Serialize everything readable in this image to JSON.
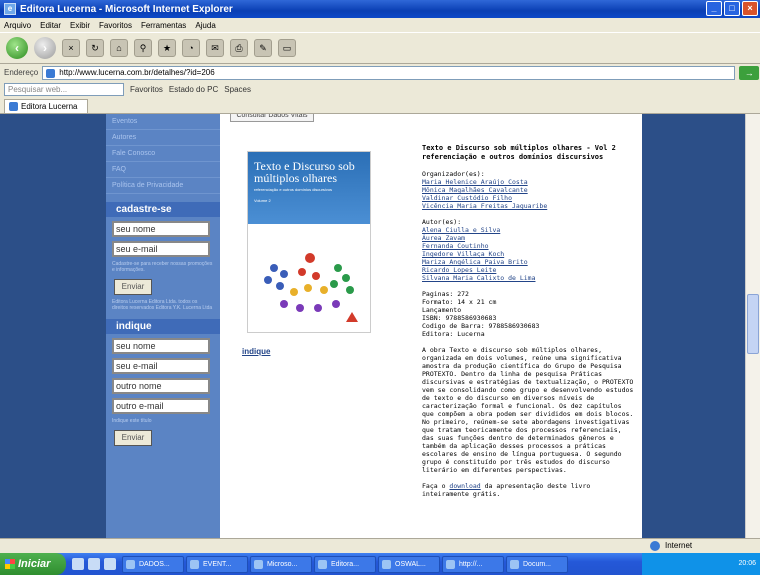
{
  "window": {
    "title": "Editora Lucerna - Microsoft Internet Explorer"
  },
  "menu": [
    "Arquivo",
    "Editar",
    "Exibir",
    "Favoritos",
    "Ferramentas",
    "Ajuda"
  ],
  "address": {
    "label": "Endereço",
    "url": "http://www.lucerna.com.br/detalhes/?id=206"
  },
  "links_bar": {
    "search_placeholder": "Pesquisar web...",
    "favorites": "Favoritos",
    "estado": "Estado do PC",
    "spaces": "Spaces"
  },
  "tab": {
    "label": "Editora Lucerna"
  },
  "sidebar": {
    "links": [
      "Eventos",
      "Autores",
      "Fale Conosco",
      "FAQ",
      "Política de Privacidade"
    ],
    "cadastre": {
      "heading": "cadastre-se",
      "name_value": "seu nome",
      "email_value": "seu e-mail",
      "note": "Cadastre-se para receber nossas promoções e informações.",
      "button": "Enviar",
      "footer_note": "Editora Lucerna Editora Ltda. todos os direitos reservados Editora Y.K. Lucerna Ltda"
    },
    "indique": {
      "heading": "indique",
      "name_value": "seu nome",
      "email_value": "seu e-mail",
      "other_name_value": "outro nome",
      "other_email_value": "outro e-mail",
      "note": "Indique este título",
      "button": "Enviar"
    }
  },
  "content": {
    "top_button": "Consultar Dados Vitais",
    "cover": {
      "title": "Texto e Discurso sob múltiplos olhares",
      "subtitle": "referenciação e outros domínios discursivos",
      "volume": "Volume 2"
    },
    "indique_link": "indique",
    "book_title": "Texto e Discurso sob múltiplos olhares - Vol 2",
    "book_subtitle": "referenciação e outros domínios discursivos",
    "organizers_label": "Organizador(es):",
    "organizers": [
      "Maria Helenice Araújo Costa",
      "Mônica Magalhães Cavalcante",
      "Valdinar Custódio Filho",
      "Vicência Maria Freitas Jaguaribe"
    ],
    "authors_label": "Autor(es):",
    "authors": [
      "Alena Ciulla e Silva",
      "Áurea Zavam",
      "Fernanda Coutinho",
      "Ingedore Villaça Koch",
      "Mariza Angélica Paiva Brito",
      "Ricardo Lopes Leite",
      "Silvana Maria Calixto de Lima"
    ],
    "details": [
      "Paginas: 272",
      "Formato: 14 x 21 cm",
      "Lançamento",
      "ISBN: 9788586930683",
      "Codigo de Barra: 9788586930683",
      "Editora: Lucerna"
    ],
    "description": "A obra Texto e discurso sob múltiplos olhares, organizada em dois volumes, reúne uma significativa amostra da produção científica do Grupo de Pesquisa PROTEXTO. Dentro da linha de pesquisa Práticas discursivas e estratégias de textualização, o PROTEXTO vem se consolidando como grupo e desenvolvendo estudos de texto e do discurso em diversos níveis de caracterização formal e funcional. Os dez capítulos que compõem a obra podem ser divididos em dois blocos. No primeiro, reúnem-se sete abordagens investigativas que tratam teoricamente dos processos referenciais, das suas funções dentro de determinados gêneros e também da aplicação desses processos a práticas escolares de ensino de língua portuguesa. O segundo grupo é constituído por três estudos do discurso literário em diferentes perspectivas.",
    "download_pre": "Faça o ",
    "download_link": "download",
    "download_post": " da apresentação deste livro inteiramente grátis."
  },
  "status": {
    "zone": "Internet"
  },
  "taskbar": {
    "start": "Iniciar",
    "tasks": [
      "DADOS...",
      "EVENT...",
      "Microso...",
      "Editora...",
      "OSWAL...",
      "http://...",
      "Docum..."
    ],
    "clock": "20:06"
  }
}
